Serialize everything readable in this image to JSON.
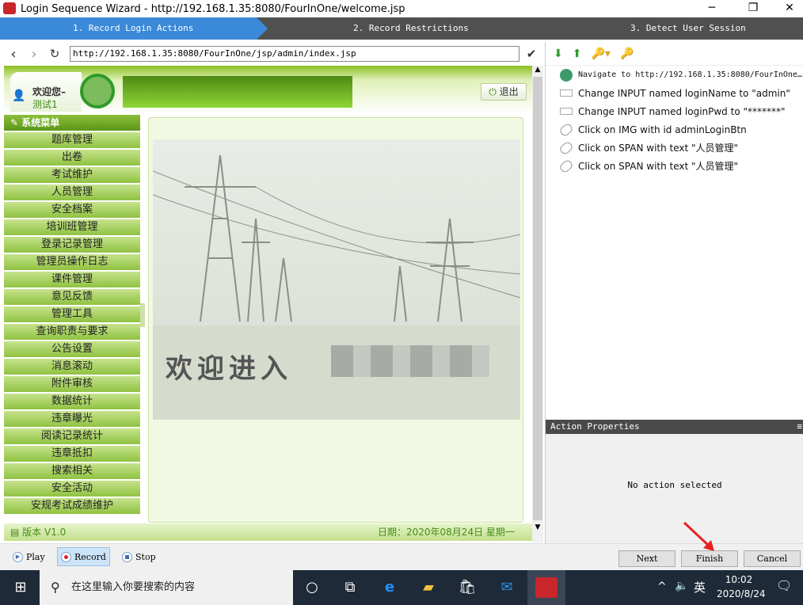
{
  "window": {
    "title": "Login Sequence Wizard - http://192.168.1.35:8080/FourInOne/welcome.jsp"
  },
  "steps": [
    "1. Record Login Actions",
    "2. Record Restrictions",
    "3. Detect User Session"
  ],
  "browser": {
    "url": "http://192.168.1.35:8080/FourInOne/jsp/admin/index.jsp"
  },
  "web": {
    "welcome": "欢迎您–",
    "user": "测试1",
    "logout": "退出",
    "menu_title": "系统菜单",
    "menu": [
      "题库管理",
      "出卷",
      "考试维护",
      "人员管理",
      "安全档案",
      "培训班管理",
      "登录记录管理",
      "管理员操作日志",
      "课件管理",
      "意见反馈",
      "管理工具",
      "查询职责与要求",
      "公告设置",
      "消息滚动",
      "附件审核",
      "数据统计",
      "违章曝光",
      "阅读记录统计",
      "违章抵扣",
      "搜索相关",
      "安全活动",
      "安规考试成绩维护"
    ],
    "welcome_banner": "欢迎进入",
    "version": "版本 V1.0",
    "date": "日期：2020年08月24日 星期一"
  },
  "actions": [
    {
      "icon": "globe-icon",
      "text": "Navigate to http://192.168.1.35:8080/FourInOne…"
    },
    {
      "icon": "input-icon",
      "text": "Change INPUT named loginName to \"admin\""
    },
    {
      "icon": "input-icon",
      "text": "Change INPUT named loginPwd to \"*******\""
    },
    {
      "icon": "mouse-icon",
      "text": "Click on IMG with id adminLoginBtn"
    },
    {
      "icon": "mouse-icon",
      "text": "Click on SPAN with text \"人员管理\""
    },
    {
      "icon": "mouse-icon",
      "text": "Click on SPAN with text \"人员管理\""
    }
  ],
  "props": {
    "title": "Action Properties",
    "empty": "No action selected"
  },
  "bottom": {
    "play": "Play",
    "record": "Record",
    "stop": "Stop",
    "next": "Next",
    "finish": "Finish",
    "cancel": "Cancel"
  },
  "taskbar": {
    "search": "在这里输入你要搜索的内容",
    "ime": "英",
    "time": "10:02",
    "date": "2020/8/24"
  },
  "colors": {
    "accent": "#3b8ad9",
    "green": "#8bc021"
  }
}
